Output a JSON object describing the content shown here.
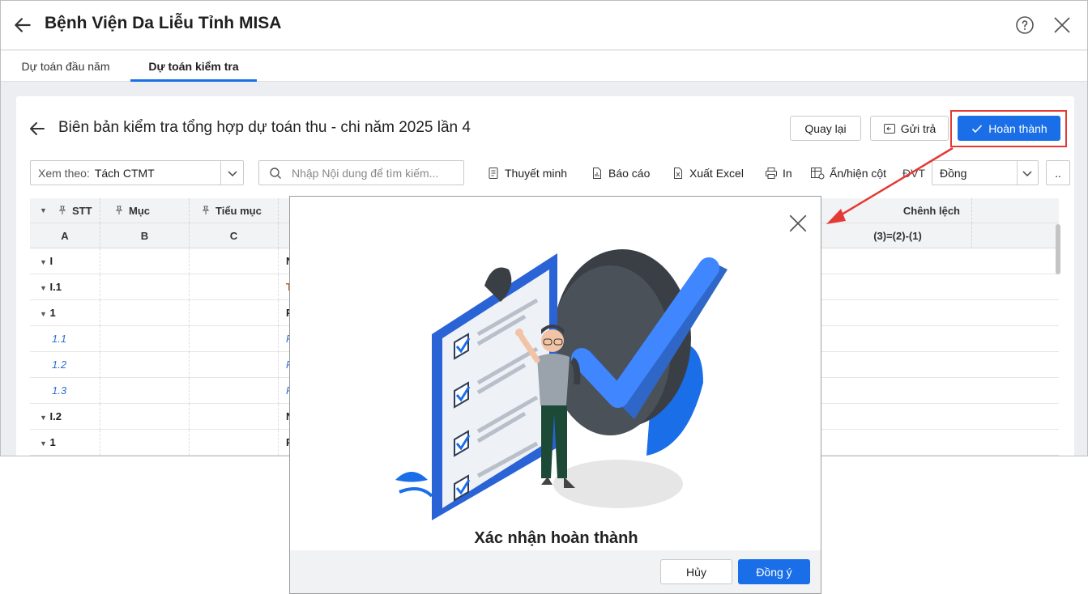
{
  "app": {
    "title": "Bệnh Viện Da Liễu Tỉnh MISA"
  },
  "tabs": [
    {
      "label": "Dự toán đầu năm"
    },
    {
      "label": "Dự toán kiểm tra"
    }
  ],
  "page": {
    "title": "Biên bản kiểm tra tổng hợp dự toán thu - chi năm 2025 lần 4",
    "back_label": "Quay lại",
    "send_back_label": "Gửi trả",
    "complete_label": "Hoàn thành"
  },
  "toolbar": {
    "view_label": "Xem theo:",
    "view_value": "Tách CTMT",
    "search_placeholder": "Nhập Nội dung để tìm kiếm...",
    "explain_label": "Thuyết minh",
    "report_label": "Báo cáo",
    "export_label": "Xuất Excel",
    "print_label": "In",
    "columns_label": "Ẩn/hiện cột",
    "unit_label": "ĐVT",
    "unit_value": "Đồng",
    "more_label": ".."
  },
  "grid": {
    "headers": {
      "stt": "STT",
      "muc": "Mục",
      "tieu_muc": "Tiểu mục",
      "chenh_lech": "Chênh lệch"
    },
    "subheaders": {
      "a": "A",
      "b": "B",
      "c": "C",
      "diff": "(3)=(2)-(1)"
    },
    "rows": [
      {
        "stt": "I",
        "content": "N"
      },
      {
        "stt": "I.1",
        "content": "T"
      },
      {
        "stt": "1",
        "content": "P"
      },
      {
        "stt": "1.1",
        "content": "P"
      },
      {
        "stt": "1.2",
        "content": "P"
      },
      {
        "stt": "1.3",
        "content": "P"
      },
      {
        "stt": "I.2",
        "content": "N"
      },
      {
        "stt": "1",
        "content": "P"
      }
    ]
  },
  "dialog": {
    "title": "Xác nhận hoàn thành",
    "cancel_label": "Hủy",
    "ok_label": "Đồng ý"
  },
  "colors": {
    "primary": "#1a6fe8",
    "highlight": "#e53935",
    "link_row": "#2f6fd1"
  }
}
